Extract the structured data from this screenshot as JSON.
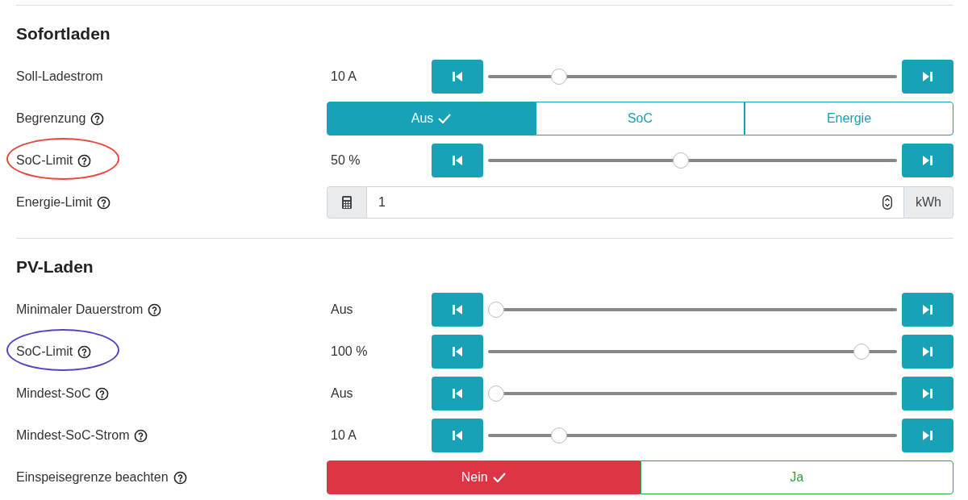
{
  "sections": [
    {
      "title": "Sofortladen",
      "rows": [
        {
          "kind": "slider",
          "label": "Soll-Ladestrom",
          "help": false,
          "value": "10 A",
          "level": 0.16
        },
        {
          "kind": "segmented",
          "label": "Begrenzung",
          "help": true,
          "options": [
            {
              "label": "Aus",
              "selected": true,
              "color": "#17a2b8"
            },
            {
              "label": "SoC",
              "selected": false,
              "color": "#17a2b8"
            },
            {
              "label": "Energie",
              "selected": false,
              "color": "#17a2b8"
            }
          ]
        },
        {
          "kind": "slider",
          "label": "SoC-Limit",
          "help": true,
          "value": "50 %",
          "level": 0.47,
          "color": "#e8483a"
        },
        {
          "kind": "number",
          "label": "Energie-Limit",
          "help": true,
          "input": "1",
          "unit": "kWh"
        }
      ]
    },
    {
      "title": "PV-Laden",
      "rows": [
        {
          "kind": "slider",
          "label": "Minimaler Dauerstrom",
          "help": true,
          "value": "Aus",
          "level": 0
        },
        {
          "kind": "slider",
          "label": "SoC-Limit",
          "help": true,
          "value": "100 %",
          "level": 0.93,
          "color": "#5b3fc4"
        },
        {
          "kind": "slider",
          "label": "Mindest-SoC",
          "help": true,
          "value": "Aus",
          "level": 0
        },
        {
          "kind": "slider",
          "label": "Mindest-SoC-Strom",
          "help": true,
          "value": "10 A",
          "level": 0.16
        },
        {
          "kind": "segmented",
          "label": "Einspeisegrenze beachten",
          "help": true,
          "options": [
            {
              "label": "Nein",
              "selected": true,
              "color": "#dc3545"
            },
            {
              "label": "Ja",
              "selected": false,
              "color": "#28a745"
            }
          ]
        }
      ]
    }
  ]
}
